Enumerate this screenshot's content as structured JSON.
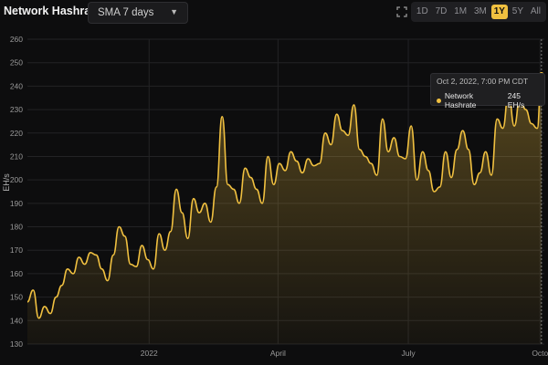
{
  "header": {
    "title": "Network Hashrate",
    "indicator_value": "SMA 7 days",
    "expand_icon": "fullscreen-icon",
    "ranges": [
      "1D",
      "7D",
      "1M",
      "3M",
      "1Y",
      "5Y",
      "All"
    ],
    "active_range": "1Y"
  },
  "tooltip": {
    "date": "Oct 2, 2022, 7:00 PM CDT",
    "series": "Network Hashrate",
    "value": "245 EH/s"
  },
  "colors": {
    "accent": "#f0c040",
    "background": "#0d0d0e",
    "grid": "#2a2a2c"
  },
  "chart_data": {
    "type": "area",
    "series": [
      {
        "name": "Network Hashrate",
        "x": [
          "2021-10-08",
          "2021-10-12",
          "2021-10-16",
          "2021-10-20",
          "2021-10-24",
          "2021-10-28",
          "2021-11-01",
          "2021-11-05",
          "2021-11-09",
          "2021-11-13",
          "2021-11-17",
          "2021-11-21",
          "2021-11-25",
          "2021-11-29",
          "2021-12-03",
          "2021-12-07",
          "2021-12-11",
          "2021-12-15",
          "2021-12-19",
          "2021-12-23",
          "2021-12-27",
          "2021-12-31",
          "2022-01-04",
          "2022-01-08",
          "2022-01-12",
          "2022-01-16",
          "2022-01-20",
          "2022-01-24",
          "2022-01-28",
          "2022-02-01",
          "2022-02-05",
          "2022-02-09",
          "2022-02-13",
          "2022-02-17",
          "2022-02-21",
          "2022-02-25",
          "2022-03-01",
          "2022-03-05",
          "2022-03-09",
          "2022-03-13",
          "2022-03-17",
          "2022-03-21",
          "2022-03-25",
          "2022-03-29",
          "2022-04-02",
          "2022-04-06",
          "2022-04-10",
          "2022-04-14",
          "2022-04-18",
          "2022-04-22",
          "2022-04-26",
          "2022-04-30",
          "2022-05-04",
          "2022-05-08",
          "2022-05-12",
          "2022-05-16",
          "2022-05-20",
          "2022-05-24",
          "2022-05-28",
          "2022-06-01",
          "2022-06-05",
          "2022-06-09",
          "2022-06-13",
          "2022-06-17",
          "2022-06-21",
          "2022-06-25",
          "2022-06-29",
          "2022-07-03",
          "2022-07-07",
          "2022-07-11",
          "2022-07-15",
          "2022-07-19",
          "2022-07-23",
          "2022-07-27",
          "2022-07-31",
          "2022-08-04",
          "2022-08-08",
          "2022-08-12",
          "2022-08-16",
          "2022-08-20",
          "2022-08-24",
          "2022-08-28",
          "2022-09-01",
          "2022-09-05",
          "2022-09-09",
          "2022-09-13",
          "2022-09-17",
          "2022-09-21",
          "2022-09-25",
          "2022-09-29",
          "2022-10-02"
        ],
        "values": [
          148,
          153,
          141,
          146,
          143,
          150,
          155,
          162,
          160,
          167,
          164,
          169,
          168,
          162,
          157,
          168,
          180,
          176,
          164,
          163,
          172,
          166,
          162,
          177,
          170,
          178,
          196,
          186,
          175,
          192,
          186,
          190,
          182,
          197,
          227,
          198,
          196,
          190,
          205,
          201,
          196,
          190,
          210,
          198,
          207,
          204,
          212,
          208,
          203,
          209,
          206,
          207,
          220,
          215,
          228,
          221,
          219,
          232,
          213,
          210,
          207,
          202,
          226,
          212,
          218,
          210,
          209,
          223,
          200,
          212,
          204,
          195,
          197,
          212,
          201,
          213,
          221,
          213,
          198,
          203,
          212,
          202,
          226,
          222,
          237,
          223,
          235,
          230,
          224,
          222,
          245
        ]
      }
    ],
    "xlabel": "",
    "ylabel": "EH/s",
    "ylim": [
      130,
      260
    ],
    "yticks": [
      130,
      140,
      150,
      160,
      170,
      180,
      190,
      200,
      210,
      220,
      230,
      240,
      250,
      260
    ],
    "xticks": [
      {
        "date": "2022-01-01",
        "label": "2022"
      },
      {
        "date": "2022-04-01",
        "label": "April"
      },
      {
        "date": "2022-07-01",
        "label": "July"
      },
      {
        "date": "2022-10-01",
        "label": "Octo"
      }
    ],
    "grid": true,
    "legend": "none"
  }
}
